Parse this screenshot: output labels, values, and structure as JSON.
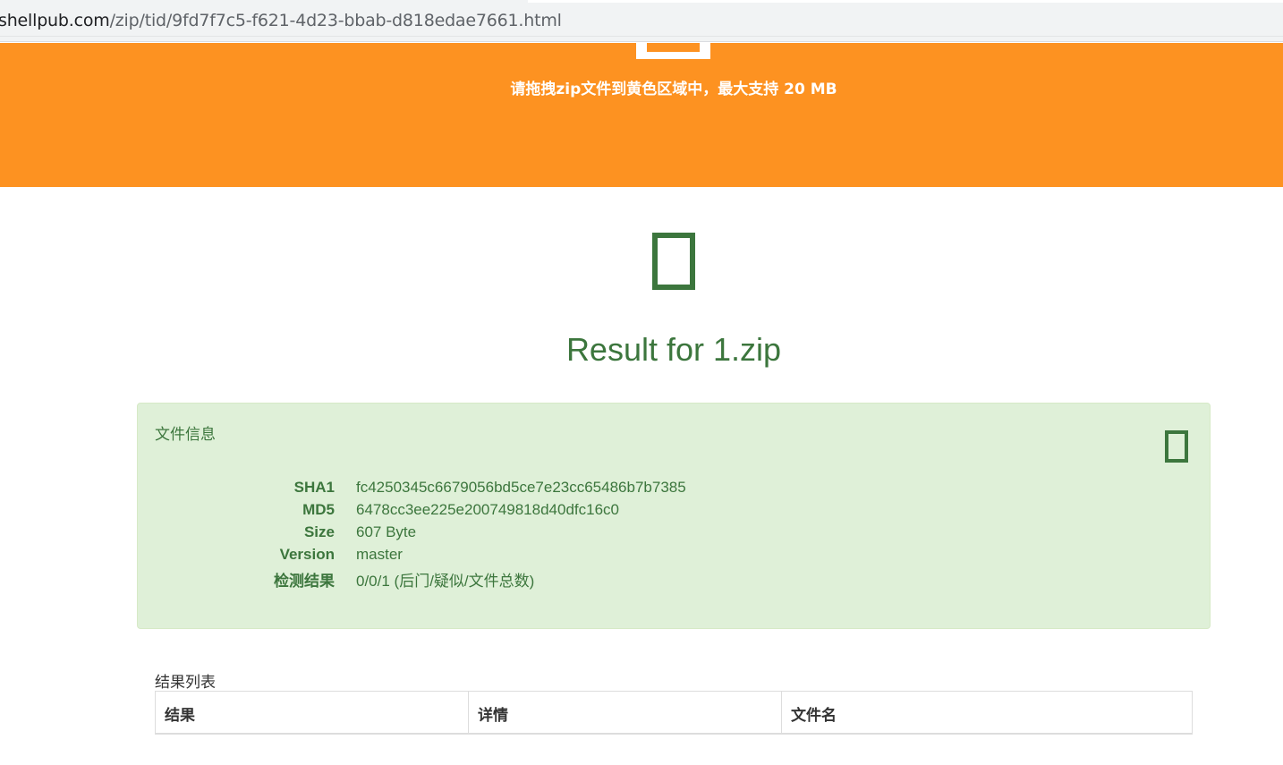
{
  "browser": {
    "url_host": "shellpub.com",
    "url_path": "/zip/tid/9fd7f7c5-f621-4d23-bbab-d818edae7661.html"
  },
  "upload": {
    "hint": "请拖拽zip文件到黄色区域中，最大支持 20 MB"
  },
  "result": {
    "title": "Result for 1.zip"
  },
  "file_info": {
    "heading": "文件信息",
    "rows": [
      {
        "key": "SHA1",
        "value": "fc4250345c6679056bd5ce7e23cc65486b7b7385"
      },
      {
        "key": "MD5",
        "value": "6478cc3ee225e200749818d40dfc16c0"
      },
      {
        "key": "Size",
        "value": "607 Byte"
      },
      {
        "key": "Version",
        "value": "master"
      },
      {
        "key": "检测结果",
        "value": "0/0/1 (后门/疑似/文件总数)"
      }
    ]
  },
  "results_list": {
    "heading": "结果列表",
    "columns": [
      "结果",
      "详情",
      "文件名"
    ]
  },
  "colors": {
    "banner": "#fd9221",
    "success_text": "#3c763d",
    "panel_bg": "#dff0d8"
  },
  "icons": {
    "banner_icon": "upload-icon",
    "result_icon": "file-check-icon",
    "panel_icon": "file-icon"
  }
}
